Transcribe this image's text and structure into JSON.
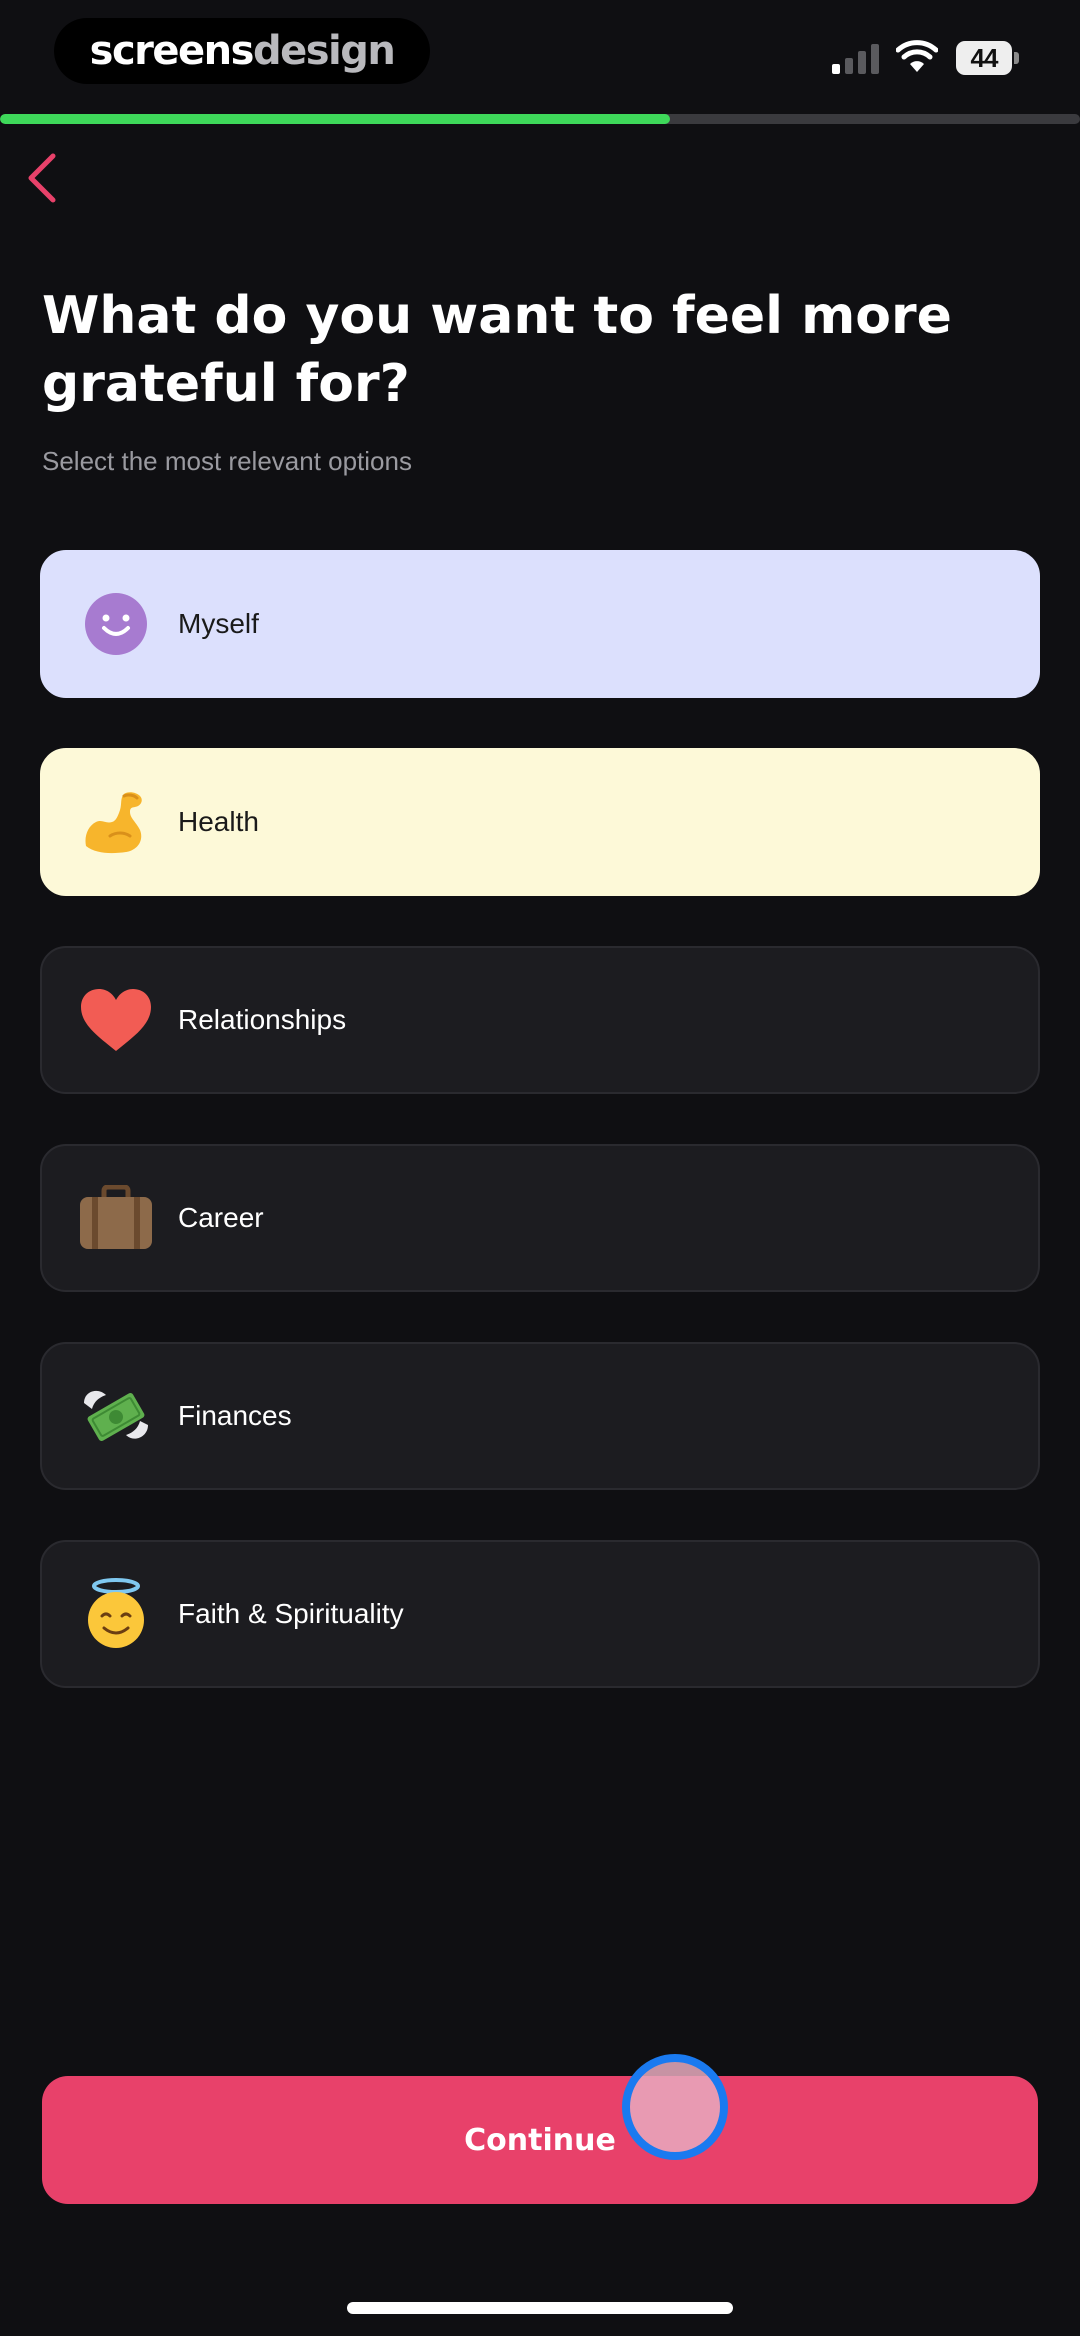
{
  "status_bar": {
    "brand_part1": "screens",
    "brand_part2": "design",
    "battery_level": "44",
    "icons": [
      "signal-icon",
      "wifi-icon",
      "battery-icon"
    ]
  },
  "progress": {
    "value_percent": 62
  },
  "back_icon": "chevron-left-icon",
  "header": {
    "title": "What do you want to feel more grateful for?",
    "subtitle": "Select the most relevant options"
  },
  "options": [
    {
      "label": "Myself",
      "icon": "smiley-face-icon",
      "selected": true
    },
    {
      "label": "Health",
      "icon": "flexed-biceps-icon",
      "selected": true
    },
    {
      "label": "Relationships",
      "icon": "heart-icon",
      "selected": false
    },
    {
      "label": "Career",
      "icon": "briefcase-icon",
      "selected": false
    },
    {
      "label": "Finances",
      "icon": "money-with-wings-icon",
      "selected": false
    },
    {
      "label": "Faith & Spirituality",
      "icon": "halo-face-icon",
      "selected": false
    }
  ],
  "continue_label": "Continue",
  "colors": {
    "accent": "#e8416a",
    "progress": "#3ed85a",
    "selected_myself": "#dce0fd",
    "selected_health": "#fdf9d8",
    "background": "#0f0f12"
  }
}
